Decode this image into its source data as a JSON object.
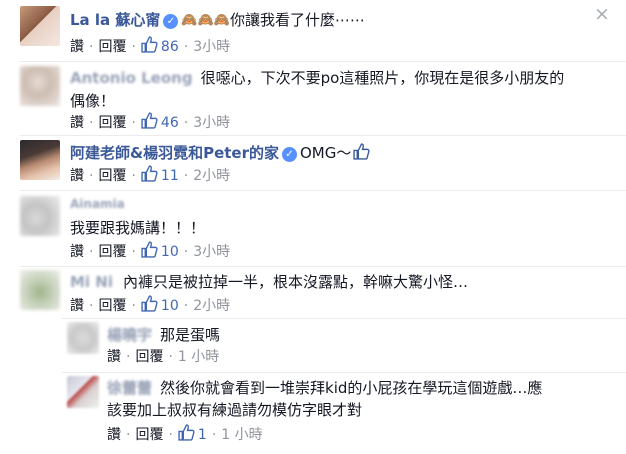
{
  "close_icon_glyph": "×",
  "comments": [
    {
      "author": "La la 蘇心甯",
      "verified": true,
      "emoji": "🙈🙈🙈",
      "text": "你讓我看了什麼⋯⋯",
      "actions": {
        "like": "讚",
        "reply": "回覆",
        "likes": "86",
        "time": "3小時"
      }
    },
    {
      "author": "Antonio Leong",
      "text_line1": "很噁心，下次不要po這種照片，你現在是很多小朋友的",
      "text_line2": "偶像！",
      "actions": {
        "like": "讚",
        "reply": "回覆",
        "likes": "46",
        "time": "3小時"
      }
    },
    {
      "author": "阿建老師&楊羽霓和Peter的家",
      "verified": true,
      "text": "OMG～",
      "actions": {
        "like": "讚",
        "reply": "回覆",
        "likes": "11",
        "time": "2小時"
      }
    },
    {
      "author": "Ainamia",
      "text": "我要跟我媽講！！！",
      "actions": {
        "like": "讚",
        "reply": "回覆",
        "likes": "10",
        "time": "3小時"
      }
    },
    {
      "author": "Mi Ni",
      "text": "內褲只是被拉掉一半，根本沒露點，幹嘛大驚小怪…",
      "actions": {
        "like": "讚",
        "reply": "回覆",
        "likes": "10",
        "time": "2小時"
      }
    }
  ],
  "replies": [
    {
      "author": "楊曉宇",
      "text": "那是蛋嗎",
      "actions": {
        "like": "讚",
        "reply": "回覆",
        "time": "1 小時"
      }
    },
    {
      "author": "徐蕾蕾",
      "text_line1": "然後你就會看到一堆崇拜kid的小屁孩在學玩這個遊戲…應",
      "text_line2": "該要加上叔叔有練過請勿模仿字眼才對",
      "actions": {
        "like": "讚",
        "reply": "回覆",
        "likes": "1",
        "time": "1 小時"
      }
    }
  ],
  "colors": {
    "link": "#3b5998",
    "like_blue": "#4267b2",
    "muted": "#90949c"
  }
}
